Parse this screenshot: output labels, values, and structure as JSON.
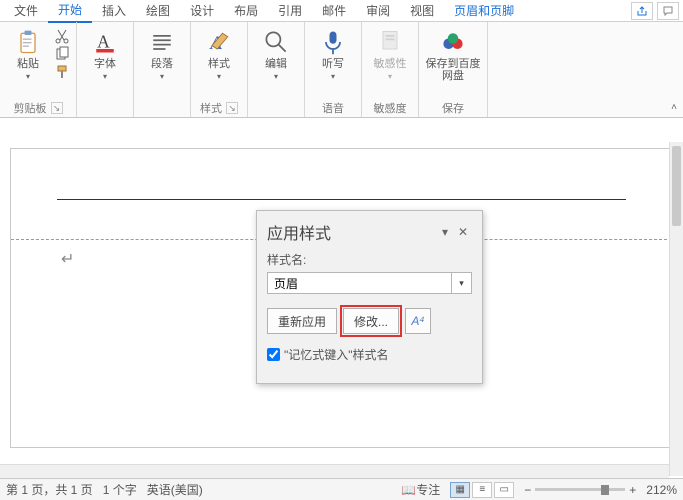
{
  "tabs": {
    "file": "文件",
    "home": "开始",
    "insert": "插入",
    "draw": "绘图",
    "design": "设计",
    "layout": "布局",
    "references": "引用",
    "mailings": "邮件",
    "review": "审阅",
    "view": "视图",
    "header_footer": "页眉和页脚"
  },
  "ribbon": {
    "clipboard": {
      "paste": "粘贴",
      "group": "剪贴板"
    },
    "font": {
      "btn": "字体"
    },
    "paragraph": {
      "btn": "段落"
    },
    "styles": {
      "btn": "样式",
      "group": "样式"
    },
    "editing": {
      "btn": "编辑"
    },
    "dictate": {
      "btn": "听写",
      "group": "语音"
    },
    "sensitivity": {
      "btn": "敏感性",
      "group": "敏感度"
    },
    "baidu": {
      "btn": "保存到百度网盘",
      "group": "保存"
    }
  },
  "pane": {
    "title": "应用样式",
    "style_name_label": "样式名:",
    "style_name_value": "页眉",
    "reapply": "重新应用",
    "modify": "修改...",
    "autocomplete": "\"记忆式键入\"样式名"
  },
  "status": {
    "page": "第 1 页，共 1 页",
    "words": "1 个字",
    "language": "英语(美国)",
    "focus": "专注",
    "zoom": "212%"
  }
}
